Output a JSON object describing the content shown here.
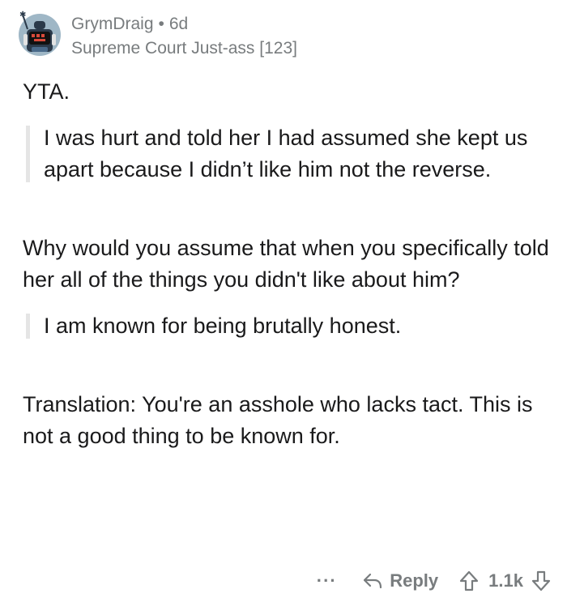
{
  "comment": {
    "username": "GrymDraig",
    "separator": "•",
    "age": "6d",
    "flair": "Supreme Court Just-ass [123]",
    "verdict": "YTA.",
    "quote1": "I was hurt and told her I had assumed she kept us apart because I didn’t like him not the reverse.",
    "para1": "Why would you assume that when you specifically told her all of the things you didn't like about him?",
    "quote2": "I am known for being brutally honest.",
    "para2": "Translation: You're an asshole who lacks tact. This is not a good thing to be known for."
  },
  "actions": {
    "more_label": "···",
    "reply_label": "Reply",
    "score": "1.1k"
  },
  "icons": {
    "avatar": "robot-avatar-icon",
    "reply": "reply-arrow-icon",
    "upvote": "upvote-arrow-icon",
    "downvote": "downvote-arrow-icon"
  },
  "colors": {
    "meta_text": "#787c7e",
    "body_text": "#1a1a1b",
    "quote_bar": "#e5e5e5",
    "avatar_bg": "#9fb7c6",
    "avatar_dark": "#2b3a4a"
  }
}
